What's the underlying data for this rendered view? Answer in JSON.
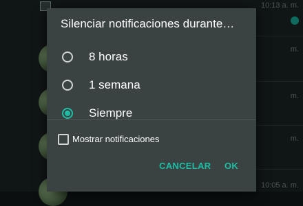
{
  "dialog": {
    "title": "Silenciar notificaciones durante…",
    "options": [
      {
        "label": "8 horas",
        "checked": false
      },
      {
        "label": "1 semana",
        "checked": false
      },
      {
        "label": "Siempre",
        "checked": true
      }
    ],
    "show_notifications": {
      "label": "Mostrar notificaciones",
      "checked": false
    },
    "buttons": {
      "cancel": "CANCELAR",
      "ok": "OK"
    }
  },
  "background": {
    "times": [
      "10:13 a. m.",
      "m.",
      "m.",
      "m.",
      "10:05 a. m."
    ]
  },
  "colors": {
    "accent": "#1ebea5",
    "dialog_bg": "#3a4242",
    "text": "#ffffff"
  }
}
